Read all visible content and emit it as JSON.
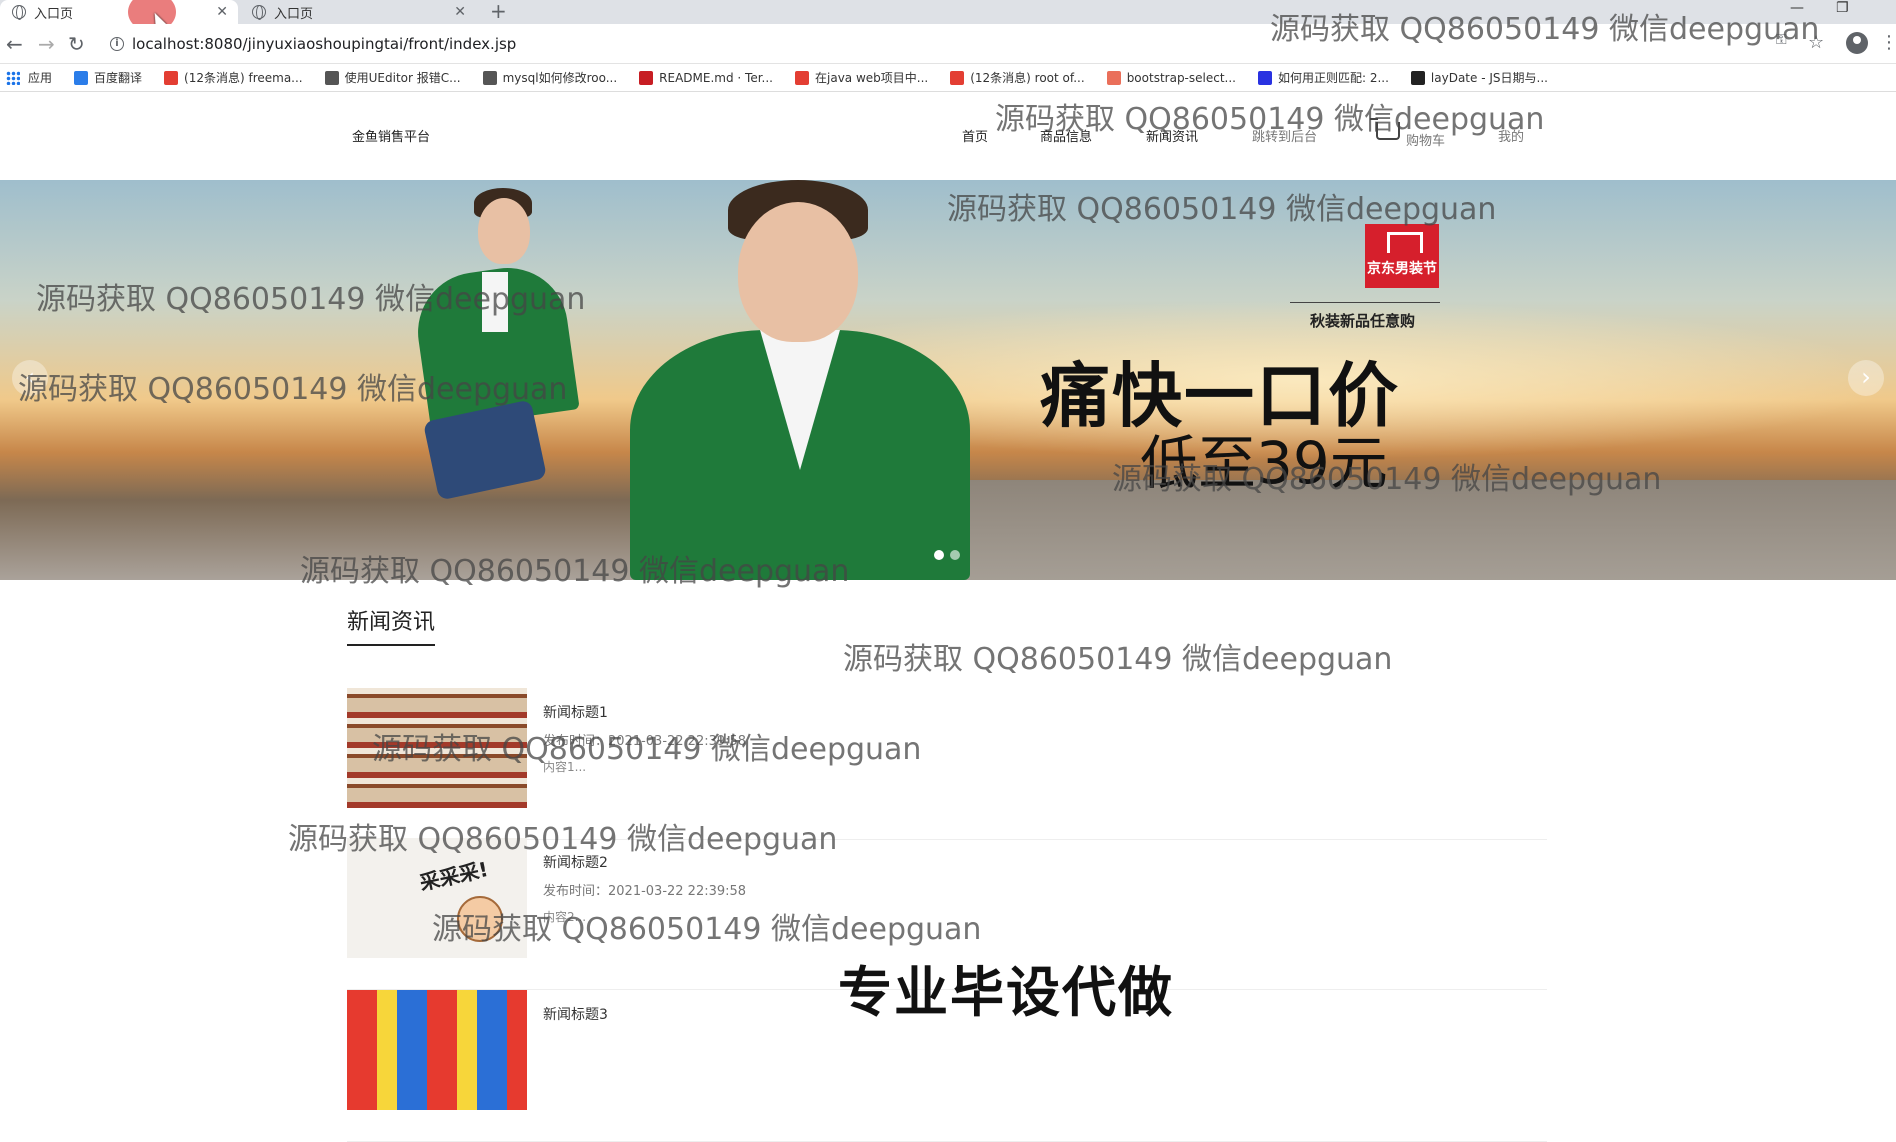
{
  "browser": {
    "tabs": [
      {
        "title": "入口页",
        "active": true
      },
      {
        "title": "入口页",
        "active": false
      }
    ],
    "new_tab_label": "+",
    "address": "localhost:8080/jinyuxiaoshoupingtai/front/index.jsp",
    "bookmarks": [
      {
        "label": "应用",
        "icon": "apps-grid-icon"
      },
      {
        "label": "百度翻译",
        "icon": "baidu-translate-icon",
        "color": "#2b7de9"
      },
      {
        "label": "(12条消息) freema...",
        "icon": "csdn-icon",
        "color": "#e33e33"
      },
      {
        "label": "使用UEditor 报错C...",
        "icon": "bird-icon",
        "color": "#555555"
      },
      {
        "label": "mysql如何修改roo...",
        "icon": "bird-icon",
        "color": "#555555"
      },
      {
        "label": "README.md · Ter...",
        "icon": "gitee-icon",
        "color": "#c71d23"
      },
      {
        "label": "在java web项目中...",
        "icon": "csdn-icon",
        "color": "#e33e33"
      },
      {
        "label": "(12条消息) root of...",
        "icon": "csdn-icon",
        "color": "#e33e33"
      },
      {
        "label": "bootstrap-select...",
        "icon": "jianshu-icon",
        "color": "#ea6f5a"
      },
      {
        "label": "如何用正则匹配: 2...",
        "icon": "baidu-paw-icon",
        "color": "#2932e1"
      },
      {
        "label": "layDate - JS日期与...",
        "icon": "layui-icon",
        "color": "#222222"
      }
    ]
  },
  "site": {
    "name": "金鱼销售平台",
    "nav": [
      "首页",
      "商品信息",
      "新闻资讯",
      "跳转到后台",
      "购物车",
      "我的"
    ]
  },
  "banner": {
    "badge": "京东男装节",
    "subtitle": "秋装新品任意购",
    "headline": "痛快一口价",
    "price": "低至39元",
    "slide_count": 2,
    "active_slide": 1
  },
  "news": {
    "section_title": "新闻资讯",
    "items": [
      {
        "title": "新闻标题1",
        "date": "发布时间：2021-03-22 22:39:58",
        "content": "内容1...",
        "thumb": "shoes"
      },
      {
        "title": "新闻标题2",
        "date": "发布时间：2021-03-22 22:39:58",
        "content": "内容2...",
        "thumb": "cartoon"
      },
      {
        "title": "新闻标题3",
        "date": "",
        "content": "",
        "thumb": "candy"
      }
    ]
  },
  "watermarks": {
    "text": "源码获取 QQ86050149 微信deepguan",
    "bold_text": "专业毕设代做"
  }
}
